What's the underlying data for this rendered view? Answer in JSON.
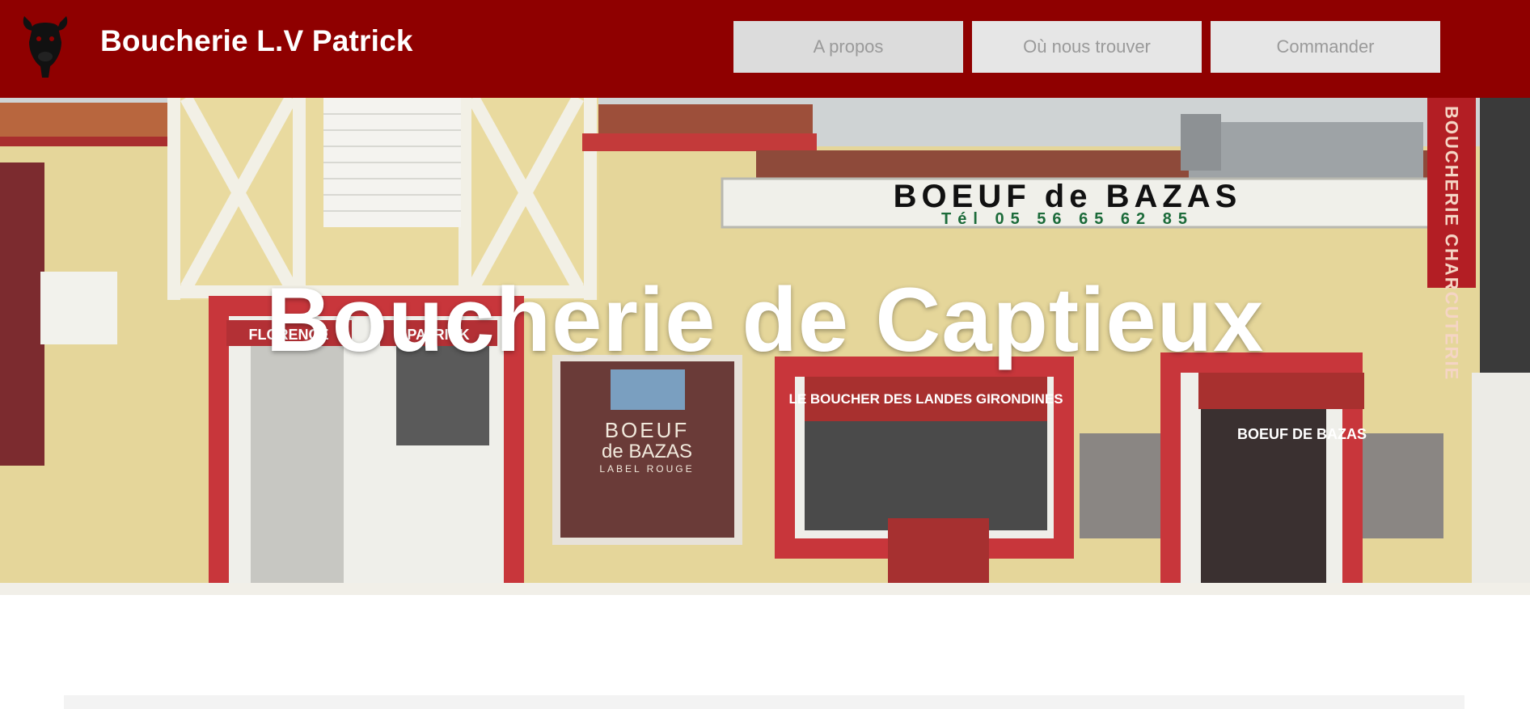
{
  "header": {
    "site_title": "Boucherie L.V Patrick",
    "logo_icon": "bull-head-icon",
    "background_color": "#8f0000"
  },
  "nav": {
    "items": [
      {
        "label": "A propos"
      },
      {
        "label": "Où nous trouver"
      },
      {
        "label": "Commander"
      }
    ],
    "button_color": "#e6e6e6",
    "text_color": "#9a9a9a"
  },
  "hero": {
    "title": "Boucherie de Captieux",
    "photo": {
      "sign_main": "BOEUF de BAZAS",
      "sign_phone": "Tél 05 56 65 62 85",
      "vertical_sign": "BOUCHERIE CHARCUTERIE",
      "awning_left": "FLORENCE",
      "awning_middle": "PATRICK",
      "plaque_top": "BOEUF",
      "plaque_middle": "de BAZAS",
      "plaque_bottom": "LABEL ROUGE",
      "awning_shop": "LE BOUCHER DES LANDES GIRONDINES",
      "awning_right": "BOEUF DE BAZAS"
    }
  }
}
